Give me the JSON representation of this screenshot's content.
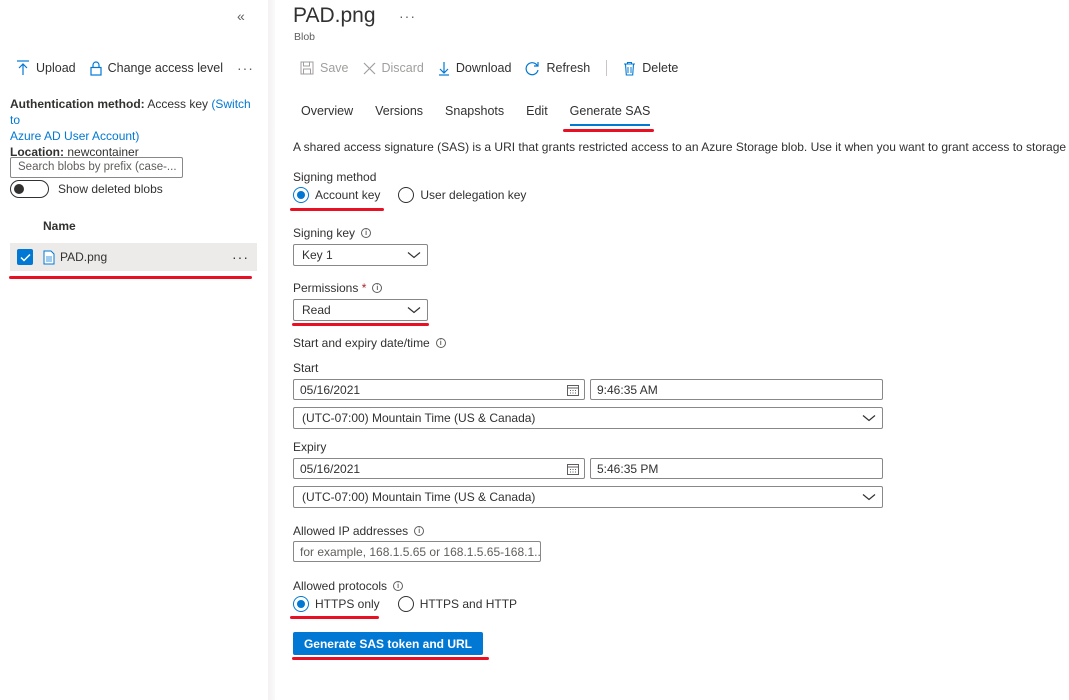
{
  "left_panel": {
    "collapse_label": "«",
    "toolbar": {
      "upload": "Upload",
      "change_access": "Change access level",
      "more": "···"
    },
    "auth": {
      "method_label": "Authentication method:",
      "method_value": "Access key",
      "switch_link_1": "(Switch to",
      "switch_link_2": "Azure AD User Account)",
      "location_label": "Location:",
      "location_value": "newcontainer"
    },
    "search_placeholder": "Search blobs by prefix (case-...",
    "show_deleted": "Show deleted blobs",
    "column_name": "Name",
    "rows": [
      {
        "name": "PAD.png",
        "more": "···"
      }
    ]
  },
  "blob": {
    "title": "PAD.png",
    "title_more": "···",
    "subtitle": "Blob"
  },
  "toolbar": {
    "save": "Save",
    "discard": "Discard",
    "download": "Download",
    "refresh": "Refresh",
    "delete": "Delete"
  },
  "tabs": [
    "Overview",
    "Versions",
    "Snapshots",
    "Edit",
    "Generate SAS"
  ],
  "active_tab": "Generate SAS",
  "sas": {
    "description": "A shared access signature (SAS) is a URI that grants restricted access to an Azure Storage blob. Use it when you want to grant access to storage account",
    "signing_method_label": "Signing method",
    "signing_method_options": [
      "Account key",
      "User delegation key"
    ],
    "signing_method_selected": "Account key",
    "signing_key_label": "Signing key",
    "signing_key_value": "Key 1",
    "permissions_label": "Permissions",
    "permissions_required": "*",
    "permissions_value": "Read",
    "date_time_label": "Start and expiry date/time",
    "start_label": "Start",
    "start_date": "05/16/2021",
    "start_time": "9:46:35 AM",
    "start_timezone": "(UTC-07:00) Mountain Time (US & Canada)",
    "expiry_label": "Expiry",
    "expiry_date": "05/16/2021",
    "expiry_time": "5:46:35 PM",
    "expiry_timezone": "(UTC-07:00) Mountain Time (US & Canada)",
    "allowed_ip_label": "Allowed IP addresses",
    "allowed_ip_placeholder": "for example, 168.1.5.65 or 168.1.5.65-168.1...",
    "allowed_protocols_label": "Allowed protocols",
    "protocol_options": [
      "HTTPS only",
      "HTTPS and HTTP"
    ],
    "protocol_selected": "HTTPS only",
    "generate_button": "Generate SAS token and URL"
  },
  "colors": {
    "accent": "#0078d4",
    "annotation": "#e81123"
  }
}
